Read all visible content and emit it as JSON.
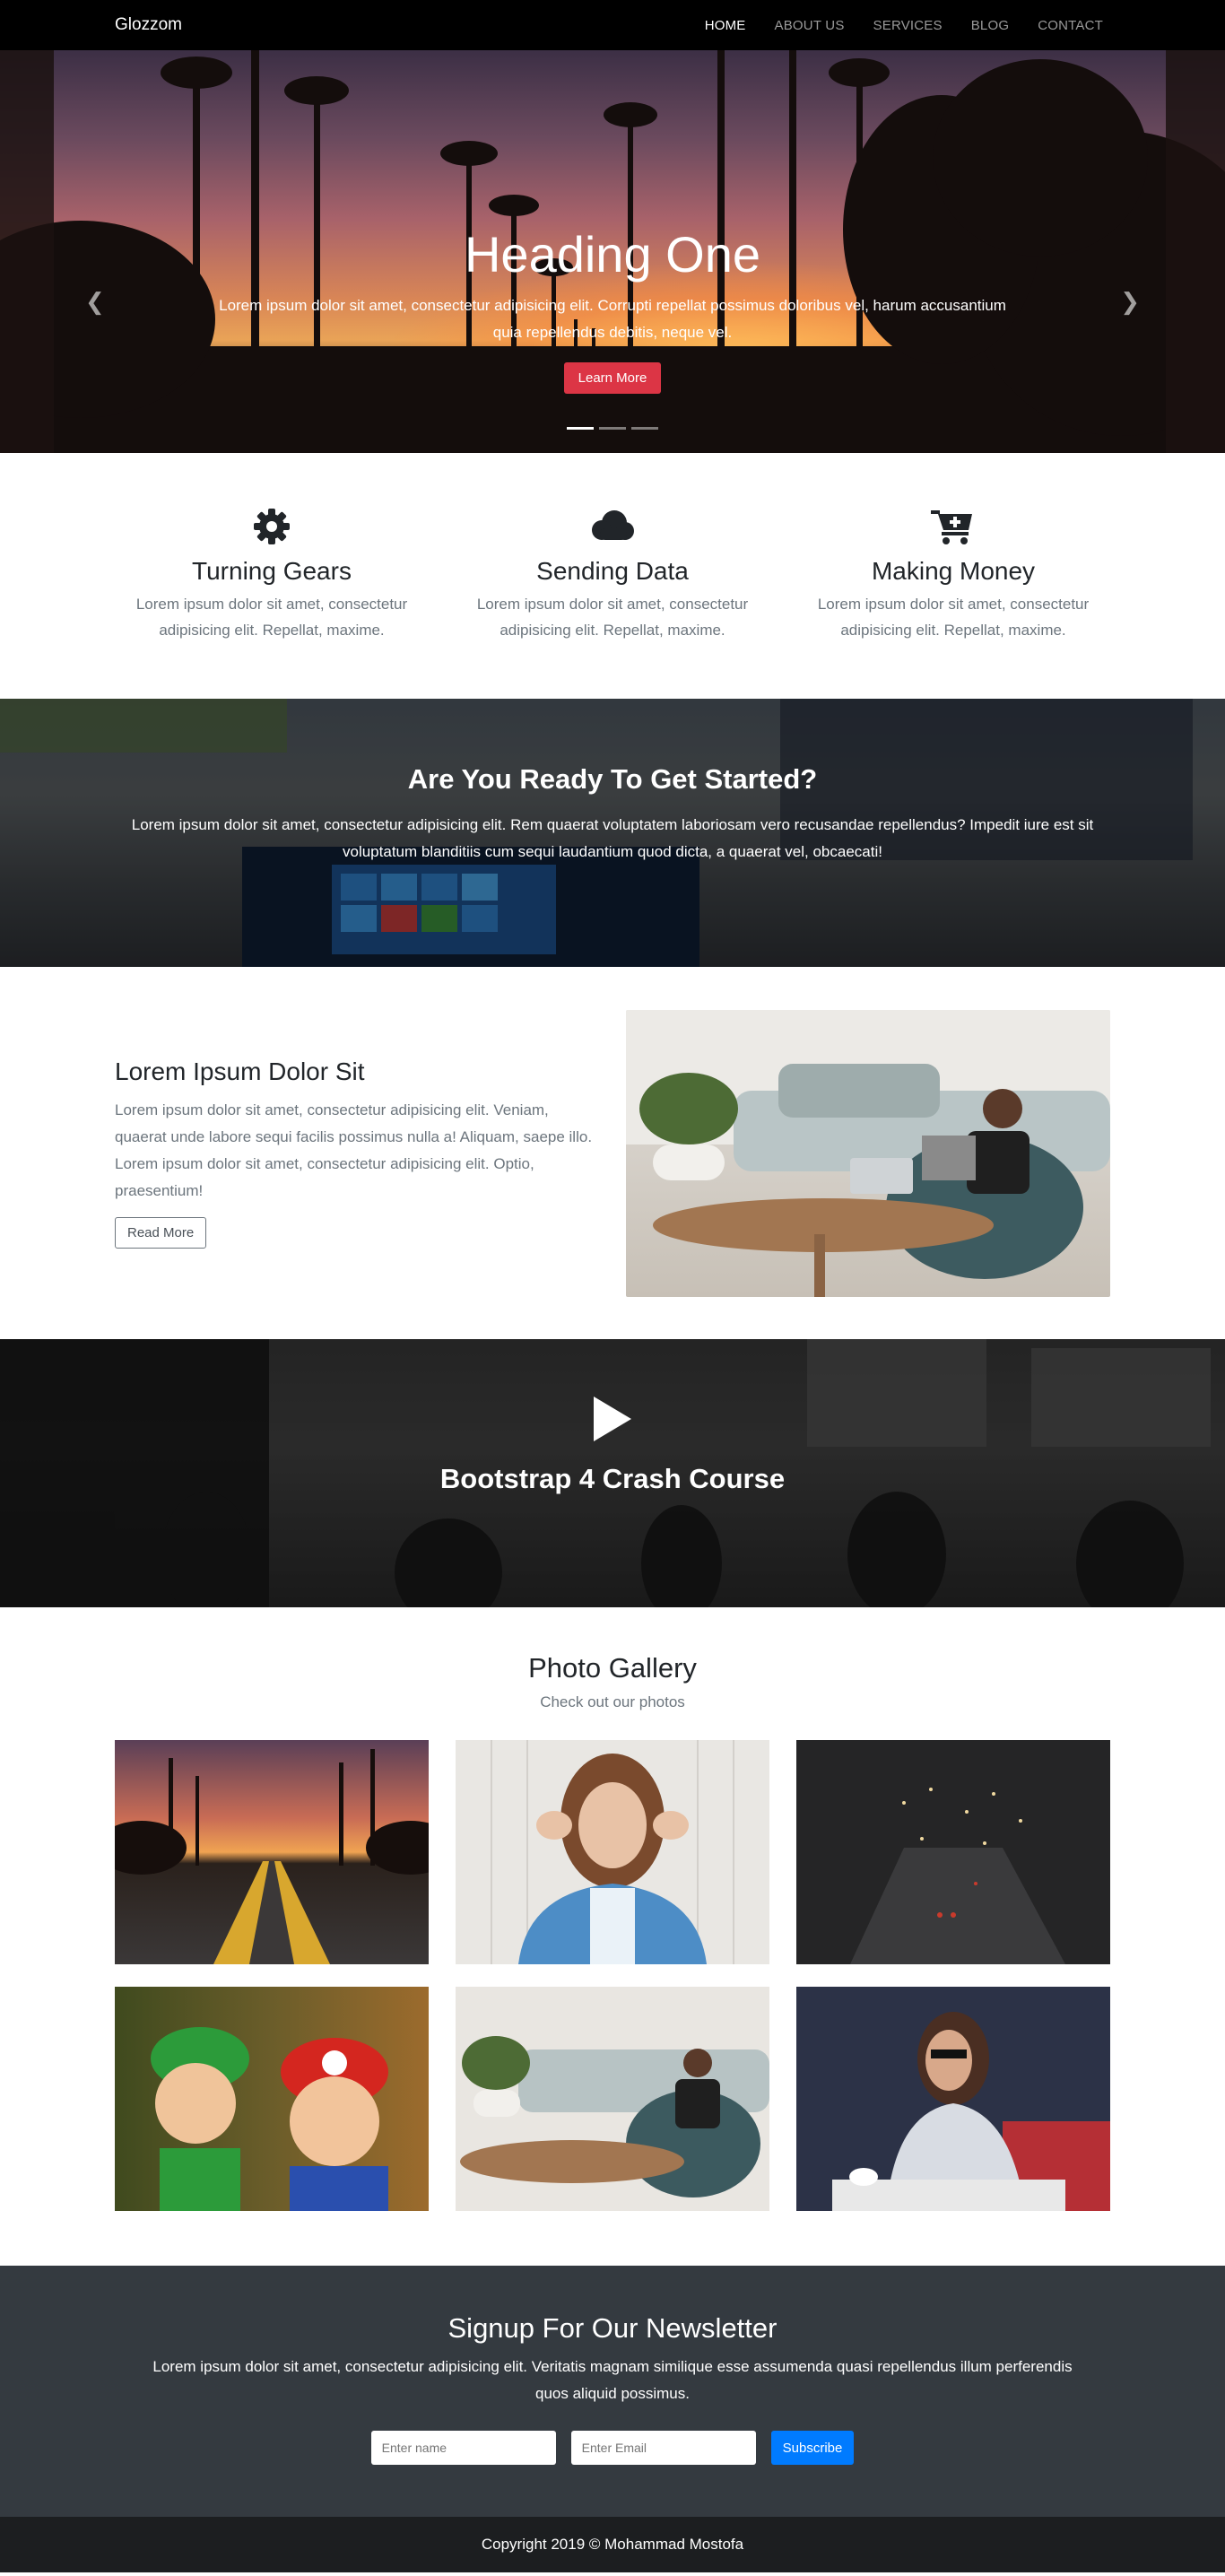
{
  "nav": {
    "brand": "Glozzom",
    "links": [
      "HOME",
      "ABOUT US",
      "SERVICES",
      "BLOG",
      "CONTACT"
    ]
  },
  "hero": {
    "heading": "Heading One",
    "text": "Lorem ipsum dolor sit amet, consectetur adipisicing elit. Corrupti repellat possimus doloribus vel, harum accusantium quia repellendus debitis, neque vel.",
    "button": "Learn More"
  },
  "features": [
    {
      "icon": "gear-icon",
      "title": "Turning Gears",
      "text": "Lorem ipsum dolor sit amet, consectetur adipisicing elit. Repellat, maxime."
    },
    {
      "icon": "cloud-icon",
      "title": "Sending Data",
      "text": "Lorem ipsum dolor sit amet, consectetur adipisicing elit. Repellat, maxime."
    },
    {
      "icon": "cart-plus-icon",
      "title": "Making Money",
      "text": "Lorem ipsum dolor sit amet, consectetur adipisicing elit. Repellat, maxime."
    }
  ],
  "ready": {
    "title": "Are You Ready To Get Started?",
    "text": "Lorem ipsum dolor sit amet, consectetur adipisicing elit. Rem quaerat voluptatem laboriosam vero recusandae repellendus? Impedit iure est sit voluptatum blanditiis cum sequi laudantium quod dicta, a quaerat vel, obcaecati!"
  },
  "info": {
    "title": "Lorem Ipsum Dolor Sit",
    "text": "Lorem ipsum dolor sit amet, consectetur adipisicing elit. Veniam, quaerat unde labore sequi facilis possimus nulla a! Aliquam, saepe illo. Lorem ipsum dolor sit amet, consectetur adipisicing elit. Optio, praesentium!",
    "button": "Read More"
  },
  "video": {
    "title": "Bootstrap 4 Crash Course"
  },
  "gallery": {
    "title": "Photo Gallery",
    "subtitle": "Check out our photos"
  },
  "newsletter": {
    "title": "Signup For Our Newsletter",
    "text": "Lorem ipsum dolor sit amet, consectetur adipisicing elit. Veritatis magnam similique esse assumenda quasi repellendus illum perferendis quos aliquid possimus.",
    "name_placeholder": "Enter name",
    "email_placeholder": "Enter Email",
    "button": "Subscribe"
  },
  "footer": {
    "copyright": "Copyright 2019 © Mohammad Mostofa"
  },
  "colors": {
    "accent_danger": "#dc3545",
    "accent_primary": "#007bff",
    "dark": "#343a40"
  }
}
